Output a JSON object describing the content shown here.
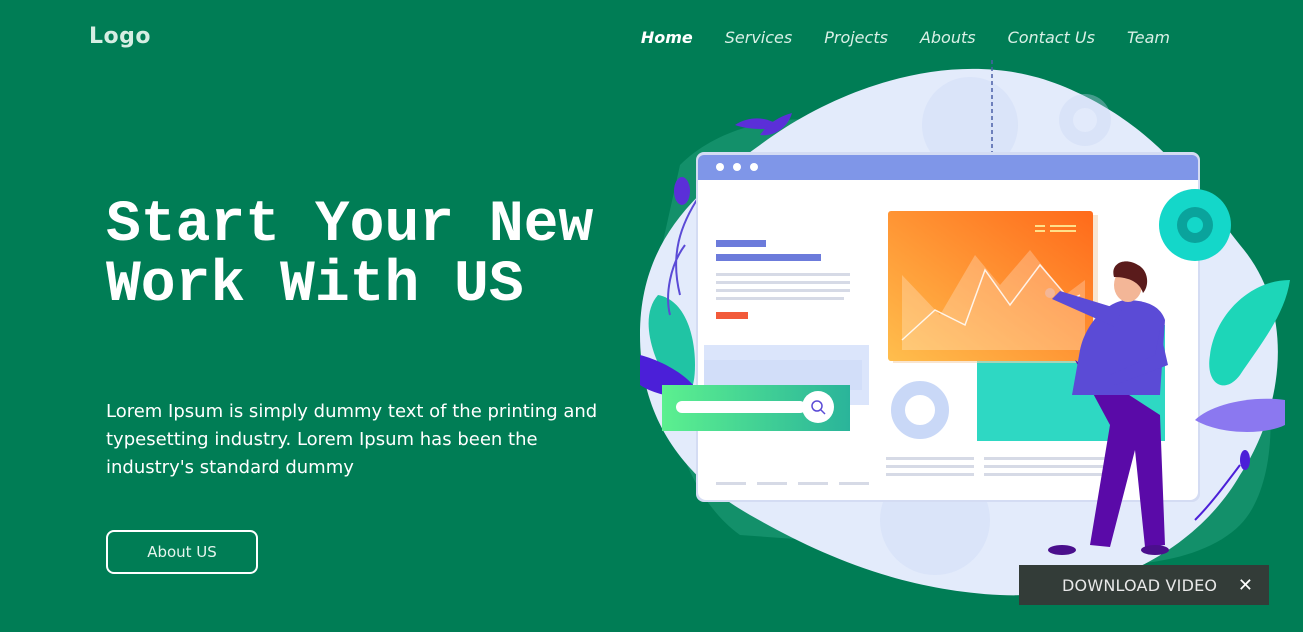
{
  "header": {
    "logo": "Logo",
    "nav": [
      {
        "label": "Home",
        "active": true
      },
      {
        "label": "Services",
        "active": false
      },
      {
        "label": "Projects",
        "active": false
      },
      {
        "label": "Abouts",
        "active": false
      },
      {
        "label": "Contact Us",
        "active": false
      },
      {
        "label": "Team",
        "active": false
      }
    ]
  },
  "hero": {
    "title_line1": "Start Your New",
    "title_line2": "Work With US",
    "description": "Lorem Ipsum is simply dummy text of the printing and typesetting industry. Lorem Ipsum has been the industry's standard dummy",
    "button_label": "About US"
  },
  "illustration": {
    "search_icon": "search-icon",
    "chart_icon": "area-chart-icon",
    "gear_icon": "gear-icon",
    "person": "person-presenting-icon"
  },
  "overlay": {
    "download_label": "DOWNLOAD VIDEO",
    "close_icon": "close-icon"
  },
  "colors": {
    "background": "#007d55",
    "blob": "#e3ebfb",
    "browser_bar": "#7f96e8",
    "chart_start": "#ffb347",
    "chart_end": "#ff6a1a",
    "teal": "#2ed8c3",
    "purple": "#5b4bd6",
    "overlay": "#333c38"
  }
}
